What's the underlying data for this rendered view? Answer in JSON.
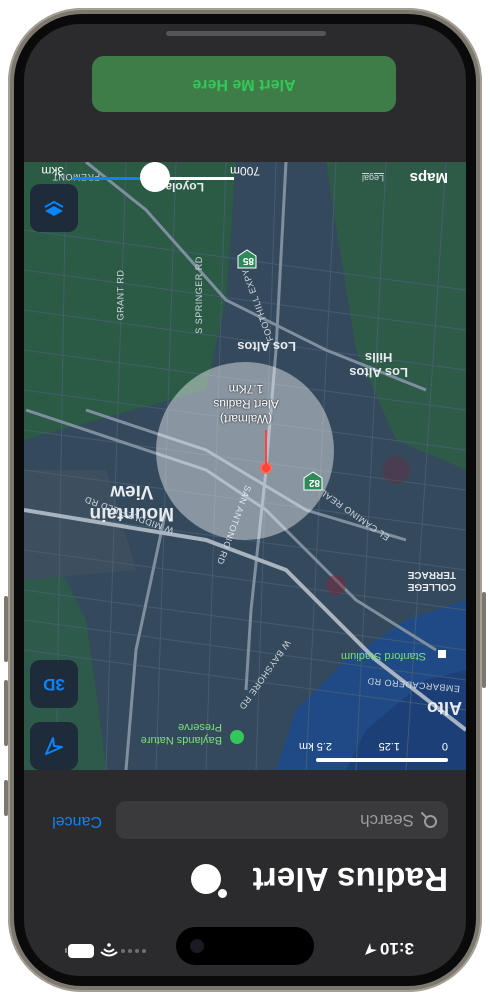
{
  "status_bar": {
    "time": "3:10"
  },
  "header": {
    "title": "Radius Alert"
  },
  "search": {
    "placeholder": "Search",
    "cancel_label": "Cancel"
  },
  "map": {
    "places": {
      "mountain_view": "Mountain\nView",
      "los_altos": "Los Altos",
      "los_altos_hills": "Los Altos\nHills",
      "alto": "Alto",
      "loyola": "Loyola",
      "college_terrace": "COLLEGE\nTERRACE"
    },
    "roads": {
      "grant_rd": "GRANT RD",
      "springer_rd": "S SPRINGER RD",
      "foothill_expy": "FOOTHILL EXPY",
      "middlefield": "W MIDDLEFIELD RD",
      "san_antonio": "SAN ANTONIO RD",
      "el_camino": "EL CAMINO REAL",
      "bayshore": "W BAYSHORE RD",
      "embarcadero": "EMBARCADERO RD",
      "fremont": "FREMONT"
    },
    "shields": {
      "route_85": "85",
      "route_82": "82"
    },
    "pois": {
      "stanford_stadium": "Stanford Stadium",
      "baylands": "Baylands Nature\nPreserve"
    },
    "pin_label": "(Walmart)\nAlert Radius\n1.7Km",
    "buttons": {
      "three_d": "3D"
    },
    "scale": {
      "ticks": [
        "0",
        "1.25",
        "2.5 km"
      ]
    },
    "brand": "Maps",
    "legal": "Legal",
    "distance": {
      "left": "3km",
      "right": "700m"
    }
  },
  "action": {
    "alert_label": "Alert Me Here"
  },
  "colors": {
    "accent": "#0a84ff",
    "green": "#34c759",
    "pin": "#ff453a"
  }
}
